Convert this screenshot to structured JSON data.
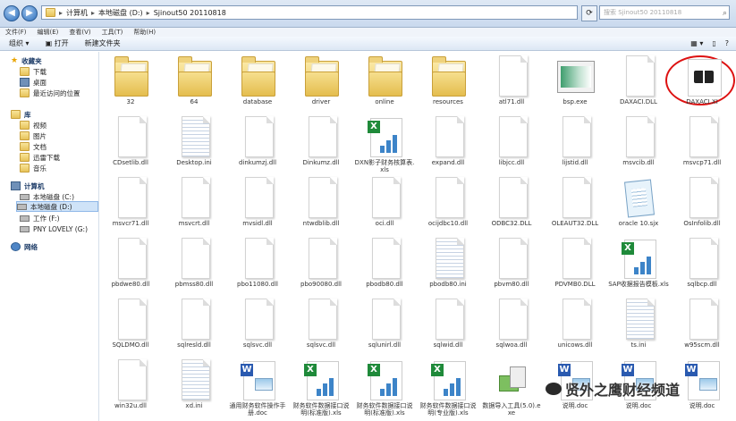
{
  "address": {
    "segments": [
      "计算机",
      "本地磁盘 (D:)",
      "Sjinout50 20110818"
    ],
    "search_placeholder": "搜索 Sjinout50 20110818"
  },
  "menu": [
    "文件(F)",
    "编辑(E)",
    "查看(V)",
    "工具(T)",
    "帮助(H)"
  ],
  "toolbar": {
    "organize": "组织 ▾",
    "open": "打开",
    "new_folder": "新建文件夹"
  },
  "sidebar": {
    "favorites": "收藏夹",
    "fav_items": [
      "下载",
      "桌面",
      "最近访问的位置"
    ],
    "libraries": "库",
    "lib_items": [
      "视频",
      "图片",
      "文档",
      "迅雷下载",
      "音乐"
    ],
    "computer": "计算机",
    "drives": [
      "本地磁盘 (C:)",
      "本地磁盘 (D:)",
      "工作 (F:)",
      "PNY LOVELY (G:)"
    ],
    "network": "网络"
  },
  "files": [
    {
      "name": "32",
      "type": "folder"
    },
    {
      "name": "64",
      "type": "folder"
    },
    {
      "name": "database",
      "type": "folder"
    },
    {
      "name": "driver",
      "type": "folder"
    },
    {
      "name": "online",
      "type": "folder"
    },
    {
      "name": "resources",
      "type": "folder"
    },
    {
      "name": "atl71.dll",
      "type": "doc"
    },
    {
      "name": "bsp.exe",
      "type": "exe"
    },
    {
      "name": "DAXACI.DLL",
      "type": "doc"
    },
    {
      "name": "DAXACI.XI",
      "type": "book"
    },
    {
      "name": "CDsetlib.dll",
      "type": "doc"
    },
    {
      "name": "Desktop.ini",
      "type": "lined"
    },
    {
      "name": "dinkumzj.dll",
      "type": "doc"
    },
    {
      "name": "Dinkumz.dll",
      "type": "doc"
    },
    {
      "name": "DXN影子财务核算表.xls",
      "type": "xls"
    },
    {
      "name": "expand.dll",
      "type": "doc"
    },
    {
      "name": "libjcc.dll",
      "type": "doc"
    },
    {
      "name": "lijstid.dll",
      "type": "doc"
    },
    {
      "name": "msvcib.dll",
      "type": "doc"
    },
    {
      "name": "msvcp71.dll",
      "type": "doc"
    },
    {
      "name": "msvcr71.dll",
      "type": "doc"
    },
    {
      "name": "msvcrt.dll",
      "type": "doc"
    },
    {
      "name": "mvsidl.dll",
      "type": "doc"
    },
    {
      "name": "ntwdblib.dll",
      "type": "doc"
    },
    {
      "name": "oci.dll",
      "type": "doc"
    },
    {
      "name": "ocijdbc10.dll",
      "type": "doc"
    },
    {
      "name": "ODBC32.DLL",
      "type": "doc"
    },
    {
      "name": "OLEAUT32.DLL",
      "type": "doc"
    },
    {
      "name": "oracle 10.sjx",
      "type": "sjx"
    },
    {
      "name": "OsInfolib.dll",
      "type": "doc"
    },
    {
      "name": "pbdwe80.dll",
      "type": "doc"
    },
    {
      "name": "pbmss80.dll",
      "type": "doc"
    },
    {
      "name": "pbo11080.dll",
      "type": "doc"
    },
    {
      "name": "pbo90080.dll",
      "type": "doc"
    },
    {
      "name": "pbodb80.dll",
      "type": "doc"
    },
    {
      "name": "pbodb80.ini",
      "type": "lined"
    },
    {
      "name": "pbvm80.dll",
      "type": "doc"
    },
    {
      "name": "PDVMB0.DLL",
      "type": "doc"
    },
    {
      "name": "SAP收据报告模板.xls",
      "type": "xls"
    },
    {
      "name": "sqlbcp.dll",
      "type": "doc"
    },
    {
      "name": "SQLDMO.dll",
      "type": "doc"
    },
    {
      "name": "sqlresld.dll",
      "type": "doc"
    },
    {
      "name": "sqlsvc.dll",
      "type": "doc"
    },
    {
      "name": "sqlsvc.dll",
      "type": "doc"
    },
    {
      "name": "sqlunirl.dll",
      "type": "doc"
    },
    {
      "name": "sqlwid.dll",
      "type": "doc"
    },
    {
      "name": "sqlwoa.dll",
      "type": "doc"
    },
    {
      "name": "unicows.dll",
      "type": "doc"
    },
    {
      "name": "ts.ini",
      "type": "lined"
    },
    {
      "name": "w95scm.dll",
      "type": "doc"
    },
    {
      "name": "win32u.dll",
      "type": "doc"
    },
    {
      "name": "xd.ini",
      "type": "lined"
    },
    {
      "name": "通用财务软件操作手册.doc",
      "type": "word"
    },
    {
      "name": "财务软件数据接口说明(标准版).xls",
      "type": "xls"
    },
    {
      "name": "财务软件数据接口说明(标准版).xls",
      "type": "xls"
    },
    {
      "name": "财务软件数据接口说明(专业版).xls",
      "type": "xls"
    },
    {
      "name": "数据导入工具(5.0).exe",
      "type": "setup"
    },
    {
      "name": "说明.doc",
      "type": "word"
    },
    {
      "name": "说明.doc",
      "type": "word"
    },
    {
      "name": "说明.doc",
      "type": "word"
    }
  ],
  "watermark": "贤外之鹰财经频道"
}
